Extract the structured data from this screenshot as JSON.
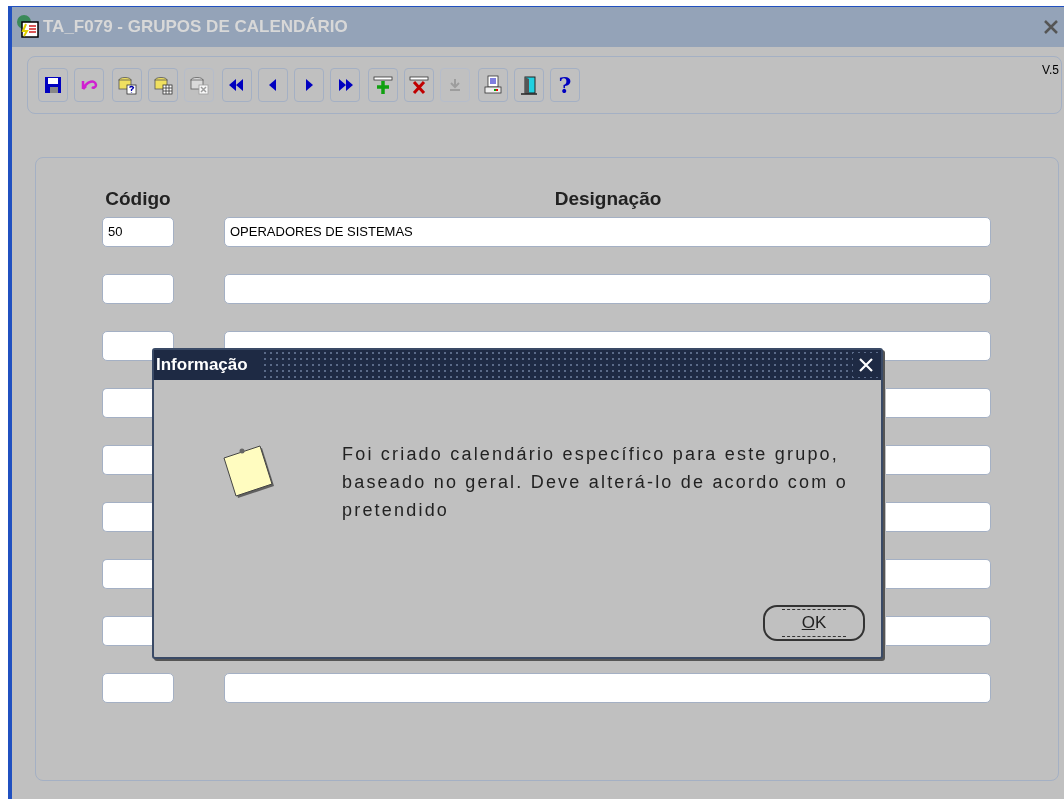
{
  "window": {
    "title": "TA_F079 - GRUPOS DE CALENDÁRIO",
    "version": "V.5"
  },
  "toolbar": [
    {
      "kind": "save",
      "disabled": false
    },
    {
      "kind": "undo",
      "disabled": false
    },
    {
      "kind": "query",
      "disabled": false
    },
    {
      "kind": "query-table",
      "disabled": false
    },
    {
      "kind": "clear",
      "disabled": true
    },
    {
      "kind": "first",
      "disabled": false
    },
    {
      "kind": "prev",
      "disabled": false
    },
    {
      "kind": "next",
      "disabled": false
    },
    {
      "kind": "last",
      "disabled": false
    },
    {
      "kind": "insert",
      "disabled": false
    },
    {
      "kind": "delete",
      "disabled": false
    },
    {
      "kind": "down",
      "disabled": true
    },
    {
      "kind": "print",
      "disabled": false
    },
    {
      "kind": "exit",
      "disabled": false
    },
    {
      "kind": "help",
      "glyph": "?",
      "disabled": false
    }
  ],
  "form": {
    "columns": [
      "Código",
      "Designação"
    ],
    "rows": [
      {
        "code": "50",
        "designation": "OPERADORES DE SISTEMAS"
      },
      {},
      {},
      {},
      {},
      {},
      {},
      {},
      {}
    ]
  },
  "dialog": {
    "title": "Informação",
    "message": "Foi criado calendário específico para este grupo, baseado no geral. Deve alterá-lo de acordo com o pretendido",
    "button": "OK"
  }
}
